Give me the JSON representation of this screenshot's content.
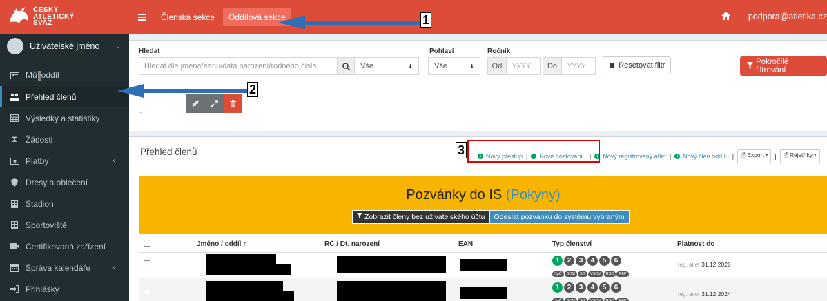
{
  "logo": {
    "line1": "ČESKÝ",
    "line2": "ATLETICKÝ",
    "line3": "SVAZ"
  },
  "user": {
    "name": "Uživatelské jméno"
  },
  "sidebar": {
    "items": [
      {
        "label": "Můj oddíl",
        "icon": "id-card-icon"
      },
      {
        "label": "Přehled členů",
        "icon": "users-icon"
      },
      {
        "label": "Výsledky a statistiky",
        "icon": "table-icon"
      },
      {
        "label": "Žádosti",
        "icon": "hourglass-icon"
      },
      {
        "label": "Platby",
        "icon": "money-icon"
      },
      {
        "label": "Dresy a oblečení",
        "icon": "shield-icon"
      },
      {
        "label": "Stadion",
        "icon": "building-icon"
      },
      {
        "label": "Sportoviště",
        "icon": "building-icon"
      },
      {
        "label": "Certifikovaná zařízení",
        "icon": "video-icon"
      },
      {
        "label": "Správa kalendáře",
        "icon": "calendar-icon"
      },
      {
        "label": "Přihlášky",
        "icon": "sign-in-icon"
      }
    ]
  },
  "topbar": {
    "nav1": "Členská sekce",
    "nav2": "Oddílová sekce",
    "support": "podpora@atletika.cz"
  },
  "filter": {
    "search_label": "Hledat",
    "search_placeholder": "Hledat dle jména/eanu/data narození/rodného čísla",
    "search_scope": "Vše",
    "gender_label": "Pohlaví",
    "gender_value": "Vše",
    "year_label": "Ročník",
    "year_from": "Od",
    "year_to": "Do",
    "year_placeholder": "YYYY",
    "reset_label": "Resetovat filtr",
    "advanced_label": "Pokročilé filtrování"
  },
  "members": {
    "title": "Přehled členů",
    "actions": {
      "transfer": "Nový přestup",
      "hosting": "Nové hostování",
      "registered": "Nový registrovaný atlet",
      "member": "Nový člen oddílu",
      "export": "Export",
      "registers": "Rejstříky"
    }
  },
  "banner": {
    "title": "Pozvánky do IS",
    "title_link": "(Pokyny)",
    "btn_show": "Zobrazit členy bez uživatelského účtu",
    "btn_send": "Odeslat pozvánku do systému vybraným"
  },
  "table": {
    "headers": [
      "Jméno / oddíl ↑",
      "RČ / Dt. narození",
      "EAN",
      "Typ členství",
      "Platnost do"
    ],
    "badge_numbers": [
      "1",
      "2",
      "3",
      "4",
      "5",
      "6"
    ],
    "badge_tags": [
      "SpČ",
      "SCM",
      "SG",
      "VSCM",
      "RSC",
      "REP"
    ],
    "rows": [
      {
        "validity_label": "reg. atlet",
        "validity_date": "31.12.2026"
      },
      {
        "validity_label": "reg. atlet",
        "validity_date": "31.12.2024"
      }
    ]
  },
  "annotations": {
    "n1": "1",
    "n2": "2",
    "n3": "3"
  }
}
